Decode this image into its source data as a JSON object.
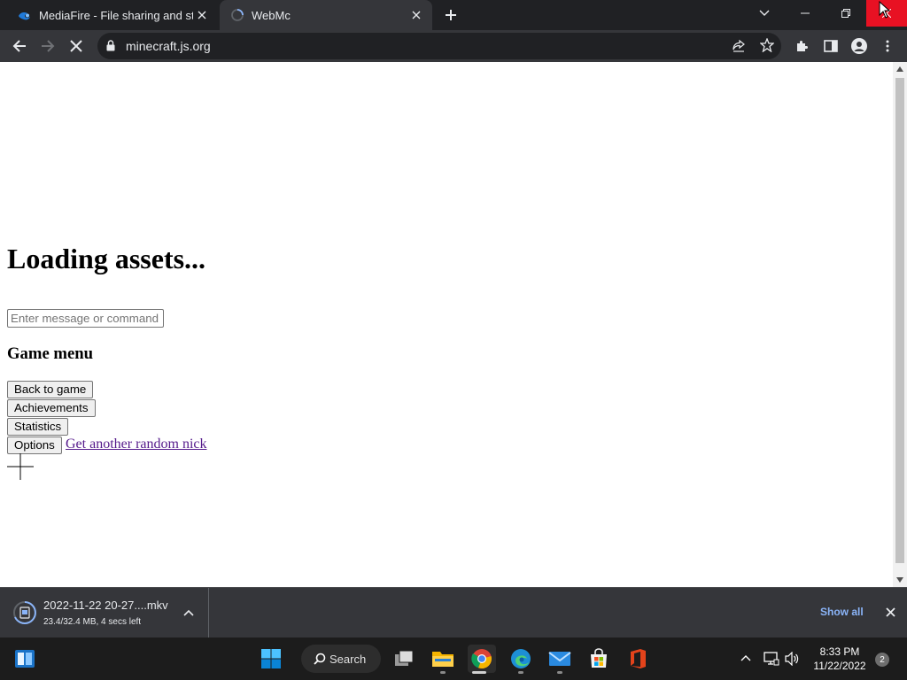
{
  "browser": {
    "tabs": [
      {
        "title": "MediaFire - File sharing and stora",
        "favicon": "mediafire-icon",
        "active": false
      },
      {
        "title": "WebMc",
        "favicon": "loading-spinner-icon",
        "active": true
      }
    ],
    "address": "minecraft.js.org"
  },
  "page": {
    "heading": "Loading assets...",
    "chat_placeholder": "Enter message or command",
    "menu_title": "Game menu",
    "buttons": [
      "Back to game",
      "Achievements",
      "Statistics",
      "Options"
    ],
    "nick_link": "Get another random nick"
  },
  "download": {
    "filename": "2022-11-22 20-27....mkv",
    "status": "23.4/32.4 MB, 4 secs left",
    "show_all": "Show all"
  },
  "taskbar": {
    "search_label": "Search",
    "time": "8:33 PM",
    "date": "11/22/2022",
    "notifications": "2"
  },
  "colors": {
    "tab_strip": "#202124",
    "toolbar": "#35363a",
    "close_hover": "#e81123",
    "link_visited": "#551a8b",
    "show_all": "#8ab4f8"
  }
}
